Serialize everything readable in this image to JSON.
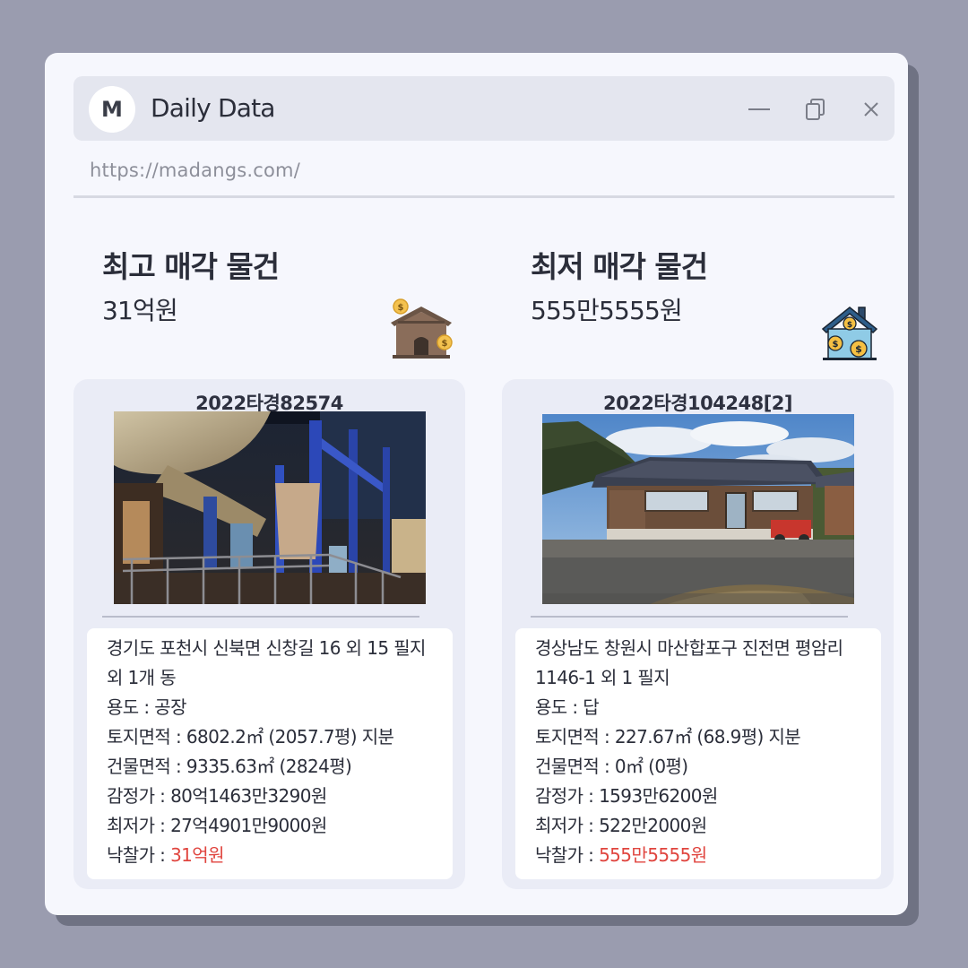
{
  "window": {
    "logo_letter": "M",
    "title": "Daily Data",
    "url": "https://madangs.com/"
  },
  "highest": {
    "heading": "최고 매각 물건",
    "price": "31억원",
    "icon": "warehouse-money-icon",
    "card": {
      "case_number": "2022타경82574",
      "photo": "factory-interior-photo",
      "address": "경기도 포천시 신북면 신창길 16 외 15 필지 외 1개 동",
      "usage_label": "용도 : ",
      "usage": "공장",
      "land_label": "토지면적 : ",
      "land_area": "6802.2㎡ (2057.7평) 지분",
      "building_label": "건물면적 : ",
      "building_area": "9335.63㎡ (2824평)",
      "appraisal_label": "감정가 : ",
      "appraisal": "80억1463만3290원",
      "minimum_label": "최저가 : ",
      "minimum": "27억4901만9000원",
      "winning_label": "낙찰가 : ",
      "winning": "31억원"
    }
  },
  "lowest": {
    "heading": "최저 매각 물건",
    "price": "555만5555원",
    "icon": "house-coins-icon",
    "card": {
      "case_number": "2022타경104248[2]",
      "photo": "rural-house-photo",
      "address": "경상남도 창원시 마산합포구 진전면 평암리 1146-1 외 1 필지",
      "usage_label": "용도 : ",
      "usage": "답",
      "land_label": "토지면적 : ",
      "land_area": "227.67㎡ (68.9평) 지분",
      "building_label": "건물면적 : ",
      "building_area": "0㎡ (0평)",
      "appraisal_label": "감정가 : ",
      "appraisal": "1593만6200원",
      "minimum_label": "최저가 : ",
      "minimum": "522만2000원",
      "winning_label": "낙찰가 : ",
      "winning": "555만5555원"
    }
  },
  "colors": {
    "background": "#9a9caf",
    "window": "#f6f7fd",
    "titlebar": "#e4e6ef",
    "card": "#eaecf6",
    "highlight": "#e0453f"
  }
}
